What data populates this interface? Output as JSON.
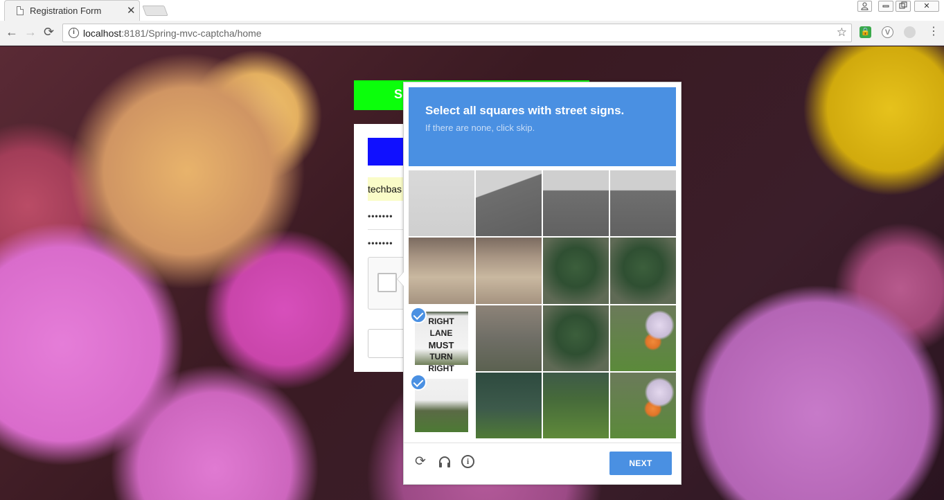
{
  "browser": {
    "tab_title": "Registration Form",
    "tab_close": "✕",
    "url_host": "localhost",
    "url_rest": ":8181/Spring-mvc-captcha/home",
    "window_controls": [
      "⍝",
      "▭",
      "❐",
      "✕"
    ]
  },
  "form": {
    "header_initial": "S",
    "username_value": "techbas",
    "password_mask": "•••••••",
    "confirm_mask": "•••••••"
  },
  "captcha": {
    "title_prefix": "Select all squares with",
    "title_target": "street signs",
    "title_suffix": ".",
    "subtitle": "If there are none, click skip.",
    "next_label": "NEXT",
    "selected_tiles": [
      8,
      12
    ],
    "sign_text_line1": "RIGHT LANE",
    "sign_text_line2": "MUST",
    "sign_text_line3": "TURN RIGHT",
    "accent_color": "#4a90e2"
  },
  "icons": {
    "reload": "⟳",
    "audio": "🎧",
    "info": "i"
  }
}
